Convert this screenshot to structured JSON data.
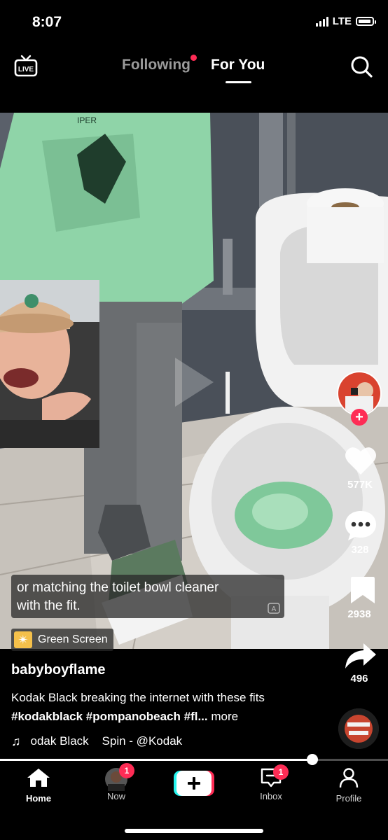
{
  "status_bar": {
    "time": "8:07",
    "network": "LTE"
  },
  "top_nav": {
    "live_label": "LIVE",
    "tabs": [
      {
        "label": "Following"
      },
      {
        "label": "For You"
      }
    ]
  },
  "video": {
    "caption": "or matching the toilet bowl cleaner\nwith the fit.",
    "effect_label": "Green Screen",
    "hoodie_text": "IPER"
  },
  "rail": {
    "likes": "577K",
    "comments": "328",
    "saves": "2938",
    "shares": "496"
  },
  "info": {
    "username": "babyboyflame",
    "description_plain": "Kodak Black breaking the internet with these fits",
    "hashtags": [
      "#kodakblack",
      "#pompanobeach",
      "#fl..."
    ],
    "more": "more",
    "music_text": "odak Black    Spin - @Kodak"
  },
  "progress": {
    "fraction": 0.805
  },
  "bottom_nav": {
    "items": [
      {
        "label": "Home"
      },
      {
        "label": "Now",
        "badge": "1"
      },
      {
        "label": ""
      },
      {
        "label": "Inbox",
        "badge": "1"
      },
      {
        "label": "Profile"
      }
    ]
  },
  "colors": {
    "accent": "#fe2c55",
    "hoodie": "#8fd4a8",
    "cleaner": "#7fc89a"
  }
}
